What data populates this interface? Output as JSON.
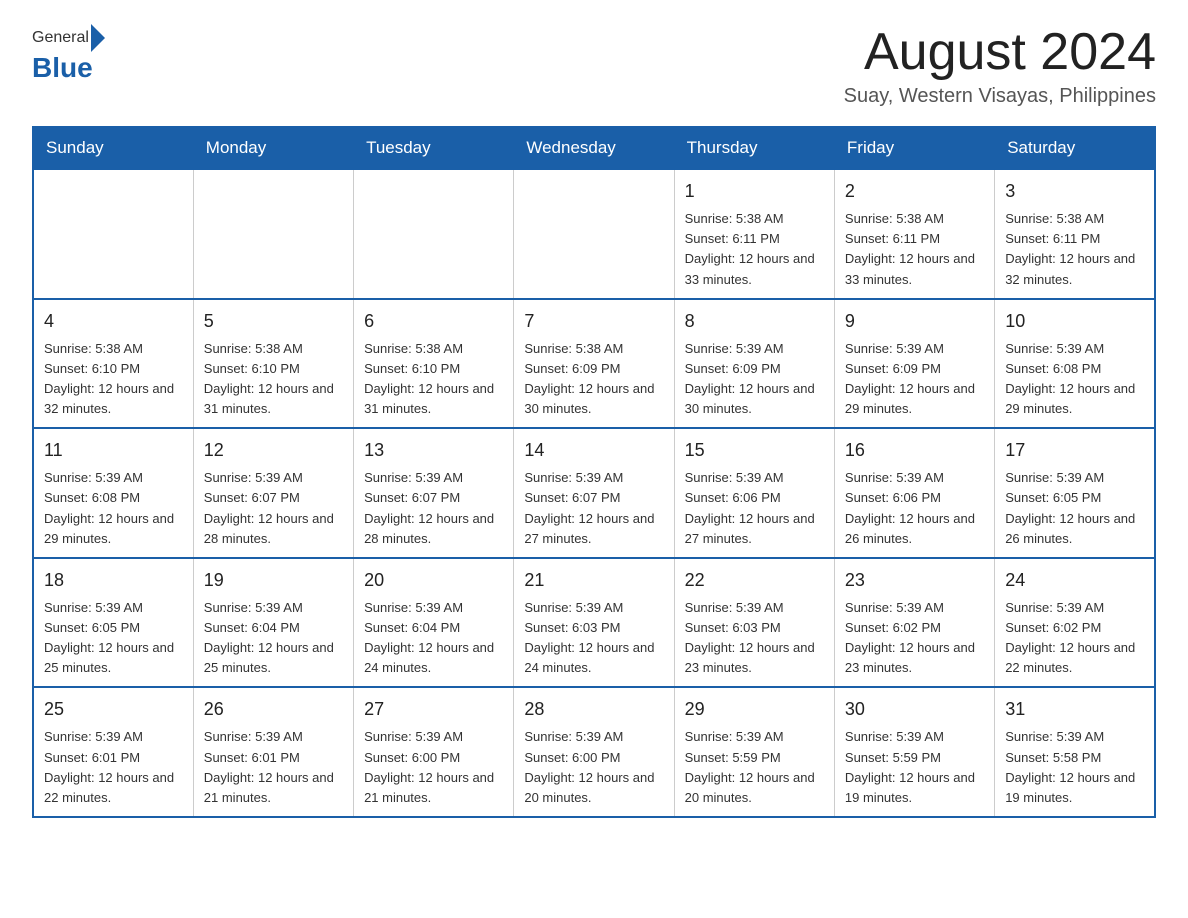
{
  "logo": {
    "general": "General",
    "blue": "Blue"
  },
  "title": "August 2024",
  "subtitle": "Suay, Western Visayas, Philippines",
  "days_of_week": [
    "Sunday",
    "Monday",
    "Tuesday",
    "Wednesday",
    "Thursday",
    "Friday",
    "Saturday"
  ],
  "weeks": [
    [
      {
        "day": "",
        "info": ""
      },
      {
        "day": "",
        "info": ""
      },
      {
        "day": "",
        "info": ""
      },
      {
        "day": "",
        "info": ""
      },
      {
        "day": "1",
        "info": "Sunrise: 5:38 AM\nSunset: 6:11 PM\nDaylight: 12 hours and 33 minutes."
      },
      {
        "day": "2",
        "info": "Sunrise: 5:38 AM\nSunset: 6:11 PM\nDaylight: 12 hours and 33 minutes."
      },
      {
        "day": "3",
        "info": "Sunrise: 5:38 AM\nSunset: 6:11 PM\nDaylight: 12 hours and 32 minutes."
      }
    ],
    [
      {
        "day": "4",
        "info": "Sunrise: 5:38 AM\nSunset: 6:10 PM\nDaylight: 12 hours and 32 minutes."
      },
      {
        "day": "5",
        "info": "Sunrise: 5:38 AM\nSunset: 6:10 PM\nDaylight: 12 hours and 31 minutes."
      },
      {
        "day": "6",
        "info": "Sunrise: 5:38 AM\nSunset: 6:10 PM\nDaylight: 12 hours and 31 minutes."
      },
      {
        "day": "7",
        "info": "Sunrise: 5:38 AM\nSunset: 6:09 PM\nDaylight: 12 hours and 30 minutes."
      },
      {
        "day": "8",
        "info": "Sunrise: 5:39 AM\nSunset: 6:09 PM\nDaylight: 12 hours and 30 minutes."
      },
      {
        "day": "9",
        "info": "Sunrise: 5:39 AM\nSunset: 6:09 PM\nDaylight: 12 hours and 29 minutes."
      },
      {
        "day": "10",
        "info": "Sunrise: 5:39 AM\nSunset: 6:08 PM\nDaylight: 12 hours and 29 minutes."
      }
    ],
    [
      {
        "day": "11",
        "info": "Sunrise: 5:39 AM\nSunset: 6:08 PM\nDaylight: 12 hours and 29 minutes."
      },
      {
        "day": "12",
        "info": "Sunrise: 5:39 AM\nSunset: 6:07 PM\nDaylight: 12 hours and 28 minutes."
      },
      {
        "day": "13",
        "info": "Sunrise: 5:39 AM\nSunset: 6:07 PM\nDaylight: 12 hours and 28 minutes."
      },
      {
        "day": "14",
        "info": "Sunrise: 5:39 AM\nSunset: 6:07 PM\nDaylight: 12 hours and 27 minutes."
      },
      {
        "day": "15",
        "info": "Sunrise: 5:39 AM\nSunset: 6:06 PM\nDaylight: 12 hours and 27 minutes."
      },
      {
        "day": "16",
        "info": "Sunrise: 5:39 AM\nSunset: 6:06 PM\nDaylight: 12 hours and 26 minutes."
      },
      {
        "day": "17",
        "info": "Sunrise: 5:39 AM\nSunset: 6:05 PM\nDaylight: 12 hours and 26 minutes."
      }
    ],
    [
      {
        "day": "18",
        "info": "Sunrise: 5:39 AM\nSunset: 6:05 PM\nDaylight: 12 hours and 25 minutes."
      },
      {
        "day": "19",
        "info": "Sunrise: 5:39 AM\nSunset: 6:04 PM\nDaylight: 12 hours and 25 minutes."
      },
      {
        "day": "20",
        "info": "Sunrise: 5:39 AM\nSunset: 6:04 PM\nDaylight: 12 hours and 24 minutes."
      },
      {
        "day": "21",
        "info": "Sunrise: 5:39 AM\nSunset: 6:03 PM\nDaylight: 12 hours and 24 minutes."
      },
      {
        "day": "22",
        "info": "Sunrise: 5:39 AM\nSunset: 6:03 PM\nDaylight: 12 hours and 23 minutes."
      },
      {
        "day": "23",
        "info": "Sunrise: 5:39 AM\nSunset: 6:02 PM\nDaylight: 12 hours and 23 minutes."
      },
      {
        "day": "24",
        "info": "Sunrise: 5:39 AM\nSunset: 6:02 PM\nDaylight: 12 hours and 22 minutes."
      }
    ],
    [
      {
        "day": "25",
        "info": "Sunrise: 5:39 AM\nSunset: 6:01 PM\nDaylight: 12 hours and 22 minutes."
      },
      {
        "day": "26",
        "info": "Sunrise: 5:39 AM\nSunset: 6:01 PM\nDaylight: 12 hours and 21 minutes."
      },
      {
        "day": "27",
        "info": "Sunrise: 5:39 AM\nSunset: 6:00 PM\nDaylight: 12 hours and 21 minutes."
      },
      {
        "day": "28",
        "info": "Sunrise: 5:39 AM\nSunset: 6:00 PM\nDaylight: 12 hours and 20 minutes."
      },
      {
        "day": "29",
        "info": "Sunrise: 5:39 AM\nSunset: 5:59 PM\nDaylight: 12 hours and 20 minutes."
      },
      {
        "day": "30",
        "info": "Sunrise: 5:39 AM\nSunset: 5:59 PM\nDaylight: 12 hours and 19 minutes."
      },
      {
        "day": "31",
        "info": "Sunrise: 5:39 AM\nSunset: 5:58 PM\nDaylight: 12 hours and 19 minutes."
      }
    ]
  ]
}
